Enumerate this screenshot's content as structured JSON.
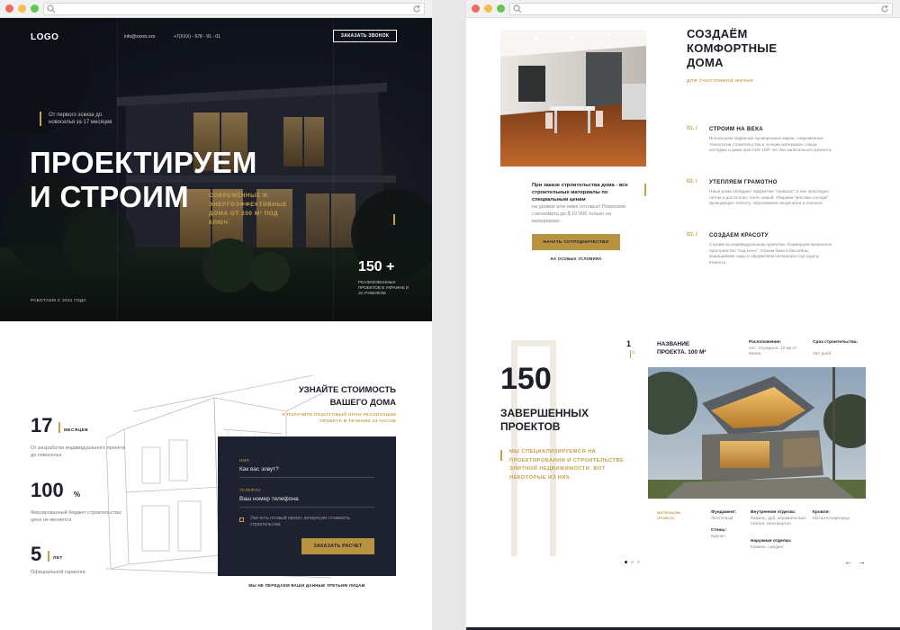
{
  "colors": {
    "gold": "#c8a04a",
    "navy": "#1d2130",
    "text_dark": "#1b1e28"
  },
  "hero": {
    "logo": "LOGO",
    "email": "info@xxxxx.xxx",
    "phone": "+7(XXX) - 678 - 91 - 01",
    "call_button": "ЗАКАЗАТЬ ЗВОНОК",
    "tagline": "От первого эскиза до новоселья за 17 месяцев",
    "title_line1": "ПРОЕКТИРУЕМ",
    "title_line2": "И СТРОИМ",
    "subtitle": "СОВРЕМЕННЫЕ И ЭНЕРГОЭФФЕКТИВНЫЕ ДОМА ОТ 200 М² ПОД КЛЮЧ",
    "stat_value": "150 +",
    "stat_label": "РЕАЛИЗОВАННЫХ ПРОЕКТОВ В УКРАИНЕ И ЗА РУБЕЖОМ",
    "since": "РАБОТАЕМ С 2011 ГОДА"
  },
  "stats": [
    {
      "value": "17",
      "unit": "МЕСЯЦЕВ",
      "desc": "От разработки индивидуального проекта до новоселья"
    },
    {
      "value": "100",
      "unit": "%",
      "desc": "Фиксированный бюджет строительства: цена не меняется"
    },
    {
      "value": "5",
      "unit": "ЛЕТ",
      "desc": "Официальной гарантии"
    }
  ],
  "cost": {
    "title": "УЗНАЙТЕ СТОИМОСТЬ ВАШЕГО ДОМА",
    "promo": "И ПОЛУЧИТЕ ПОШАГОВЫЙ ПЛАН РЕАЛИЗАЦИИ ПРОЕКТА В ТЕЧЕНИЕ 24 ЧАСОВ",
    "name_label": "ИМЯ",
    "name_placeholder": "Как вас зовут?",
    "phone_label": "ТЕЛЕФОН",
    "phone_placeholder": "Ваш номер телефона",
    "consent": "Уже есть готовый проект, интересует стоимость строительства",
    "submit": "ЗАКАЗАТЬ РАСЧЕТ",
    "privacy": "МЫ НЕ ПЕРЕДАЕМ ВАШИ ДАННЫЕ ТРЕТЬИМ ЛИЦАМ"
  },
  "about": {
    "title_line1": "СОЗДАЁМ",
    "title_line2": "КОМФОРТНЫЕ",
    "title_line3": "ДОМА",
    "subtitle": "ДЛЯ СЧАСТЛИВОЙ ЖИЗНИ",
    "caption": "При заказе строительства дома - все строительные материалы по специальным ценам",
    "note": "на уровне или ниже оптовых! Помогаем сэкономить до $ 10 000 только на материалах.",
    "button": "НАЧАТЬ СОТРУДНИЧЕСТВО",
    "button_note": "НА ОСОБЫХ УСЛОВИЯХ",
    "features": [
      {
        "num": "01. /",
        "title": "СТРОИМ НА ВЕКА",
        "text": "Используем надежные проверенные марки, современные технологии строительства и лучшие материалы. Наши коттеджи и дома простоят 100* лет без капитального ремонта."
      },
      {
        "num": "02. /",
        "title": "УТЕПЛЯЕМ ГРАМОТНО",
        "text": "Наши дома обладают эффектом \"термоса\": в них прохладно летом и достаточно тепло зимой. Убираем \"мостики холода\", проводящую теплоту, образование конденсата и плесени."
      },
      {
        "num": "03. /",
        "title": "СОЗДАЕМ КРАСОТУ",
        "text": "Строим по индивидуальным проектам. Формируем жизненное пространство \"под ключ\": строим бани и бассейны, выращиваем сады и оформляем интерьеры под задачу Клиента."
      }
    ]
  },
  "projects": {
    "count": "150",
    "heading_line1": "ЗАВЕРШЕННЫХ",
    "heading_line2": "ПРОЕКТОВ",
    "desc": "МЫ СПЕЦИАЛИЗИРУЕМСЯ НА ПРОЕКТИРОВАНИИ И СТРОИТЕЛЬСТВЕ ЭЛИТНОЙ НЕДВИЖИМОСТИ. ВОТ НЕКОТОРЫЕ ИЗ НИХ:",
    "pager_current": "1",
    "pager_total": "/3",
    "name_line1": "НАЗВАНИЕ",
    "name_line2": "ПРОЕКТА. 100 М²",
    "location_k": "Расположение:",
    "location_v": "пос. Отрадное, 10 км от Киева",
    "term_k": "Срок строительства:",
    "term_v": "450 дней",
    "materials_label": "МАТЕРИАЛЫ ПРОЕКТА:",
    "foundation_k": "Фундамент:",
    "foundation_v": "Ленточный",
    "walls_k": "Стены:",
    "walls_v": "Кирпич",
    "interior_k": "Внутренняя отделка:",
    "interior_v": "Камень, дуб, керамическая плитка, гипсокартон",
    "exterior_k": "Наружная отделка:",
    "exterior_v": "Камень, сайдинг",
    "roof_k": "Кровля:",
    "roof_v": "Металлочерепица",
    "prev": "←",
    "next": "→"
  }
}
